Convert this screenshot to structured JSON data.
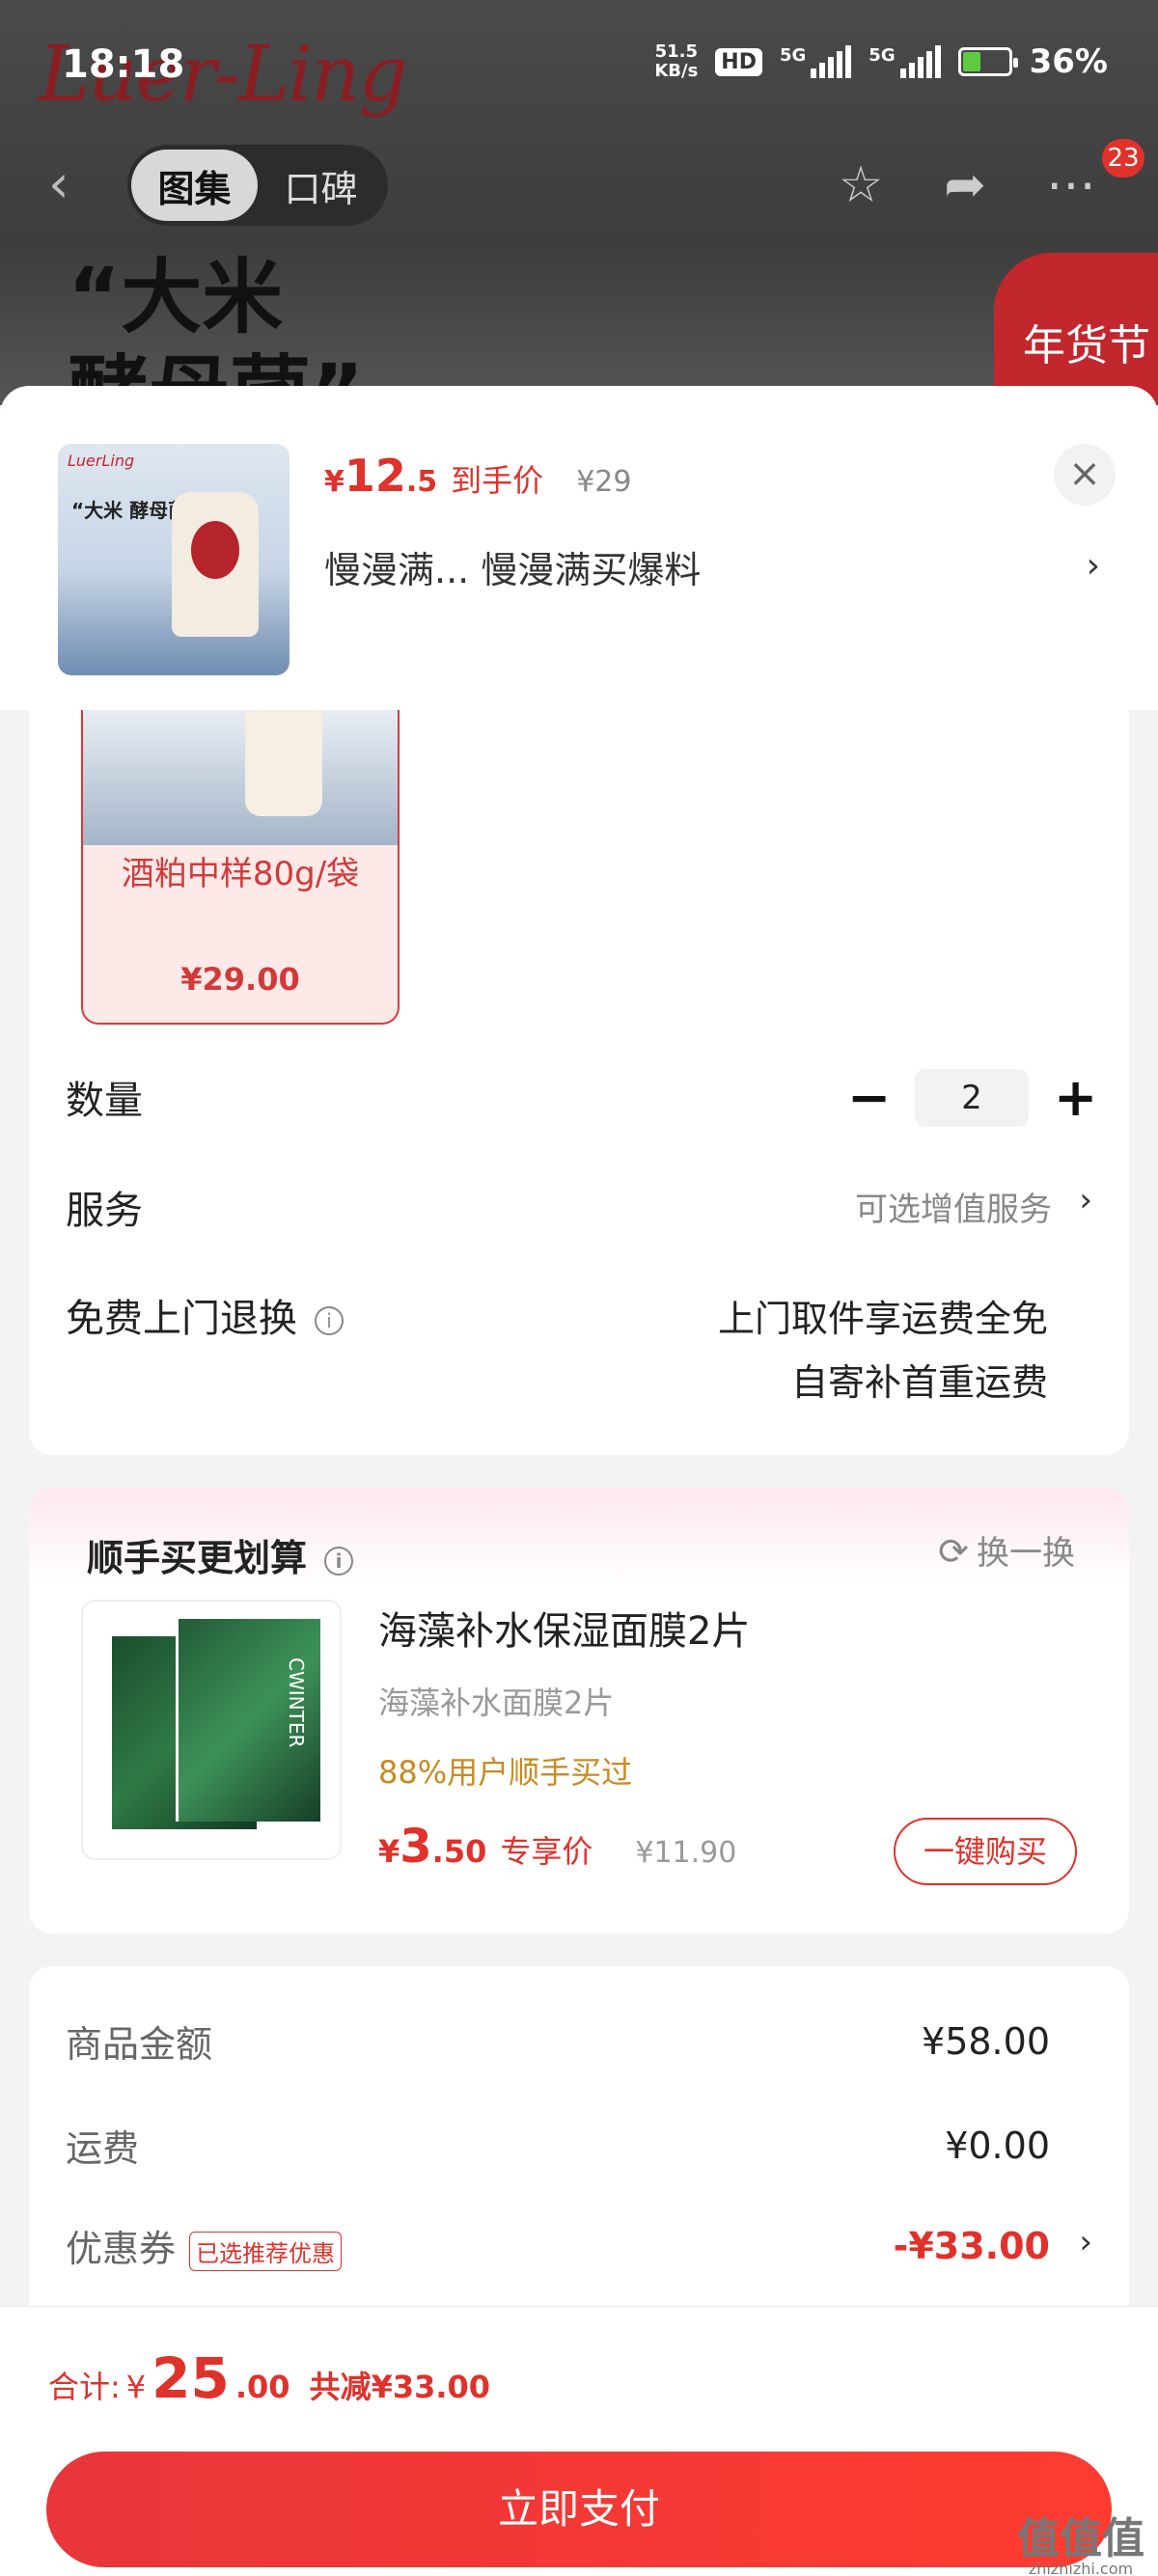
{
  "status_bar": {
    "time": "18:18",
    "net_speed_value": "51.5",
    "net_speed_unit": "KB/s",
    "hd": "HD",
    "signal_label_1": "5G",
    "signal_label_2": "5G",
    "battery_percent": "36%"
  },
  "backdrop": {
    "brand_logo": "Luer-Ling",
    "hero_text_line1": "“大米",
    "hero_text_line2": "酵母菌”",
    "sticker": "年货节"
  },
  "nav": {
    "tabs": [
      {
        "label": "图集",
        "active": true
      },
      {
        "label": "口碑",
        "active": false
      }
    ],
    "notification_count": "23"
  },
  "sheet_header": {
    "thumb_brand": "LuerLing",
    "thumb_title": "“大米 酵母菌”",
    "price_symbol": "¥",
    "price_int": "12",
    "price_dec": ".5",
    "price_tag": "到手价",
    "price_original": "¥29",
    "promo_text": "慢漫满...  慢漫满买爆料"
  },
  "sku": {
    "name": "酒粕中样80g/袋",
    "price": "¥29.00"
  },
  "quantity": {
    "label": "数量",
    "value": "2",
    "minus": "−",
    "plus": "+"
  },
  "service": {
    "label": "服务",
    "value": "可选增值服务"
  },
  "return_policy": {
    "label": "免费上门退换",
    "line1": "上门取件享运费全免",
    "line2": "自寄补首重运费"
  },
  "recommend": {
    "title": "顺手买更划算",
    "swap_label": "换一换",
    "product_brand": "CWINTER",
    "product_title": "海藻补水保湿面膜2片",
    "product_subtitle": "海藻补水面膜2片",
    "purchase_rate": "88%用户顺手买过",
    "price_symbol": "¥",
    "price_int": "3",
    "price_dec": ".50",
    "price_tag": "专享价",
    "price_original": "¥11.90",
    "buy_button": "一键购买"
  },
  "summary": {
    "goods_label": "商品金额",
    "goods_value": "¥58.00",
    "shipping_label": "运费",
    "shipping_value": "¥0.00",
    "coupon_label": "优惠券",
    "coupon_tag": "已选推荐优惠",
    "coupon_value": "-¥33.00"
  },
  "footer": {
    "total_label": "合计:",
    "total_symbol": "¥",
    "total_int": "25",
    "total_dec": ".00",
    "discount": "共减¥33.00",
    "pay_button": "立即支付"
  },
  "watermark": {
    "main": "值值值",
    "sub": "zhizhizhi.com"
  },
  "colors": {
    "accent": "#e0312b",
    "sku_border": "#d8393d",
    "highlight_orange": "#c98a1f"
  }
}
